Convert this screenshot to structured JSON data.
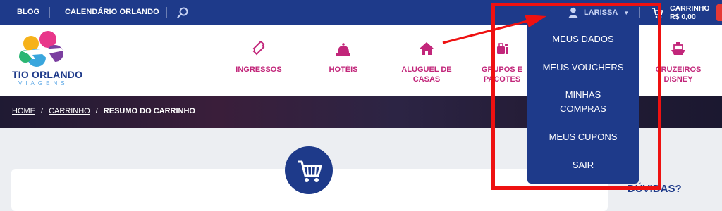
{
  "topbar": {
    "blog": "BLOG",
    "calendar": "CALENDÁRIO ORLANDO",
    "search_icon": "search-icon",
    "user_name": "LARISSA",
    "cart_label": "CARRINHO",
    "cart_total": "R$ 0,00"
  },
  "logo": {
    "name": "TIO ORLANDO",
    "sub": "VIAGENS"
  },
  "nav": [
    {
      "label": "INGRESSOS",
      "icon": "ticket-icon"
    },
    {
      "label": "HOTÉIS",
      "icon": "bell-icon"
    },
    {
      "label": "ALUGUEL DE CASAS",
      "line1": "ALUGUEL DE",
      "line2": "CASAS",
      "icon": "house-icon"
    },
    {
      "label": "GRUPOS E PACOTES",
      "line1": "GRUPOS E",
      "line2": "PACOTES",
      "icon": "luggage-icon"
    },
    {
      "label": "CRUZEIROS DISNEY",
      "line1": "CRUZEIROS",
      "line2": "DISNEY",
      "icon": "ship-icon"
    }
  ],
  "breadcrumb": {
    "home": "HOME",
    "cart": "CARRINHO",
    "current": "RESUMO DO CARRINHO",
    "sep": "/"
  },
  "dropdown": {
    "items": [
      "MEUS DADOS",
      "MEUS VOUCHERS",
      "MINHAS COMPRAS",
      "MEUS CUPONS",
      "SAIR"
    ],
    "compras_line1": "MINHAS",
    "compras_line2": "COMPRAS"
  },
  "sidebar": {
    "help_title": "DÚVIDAS?"
  },
  "colors": {
    "navy": "#1e3a8a",
    "magenta": "#c2267a",
    "annotation_red": "#ee1111"
  }
}
